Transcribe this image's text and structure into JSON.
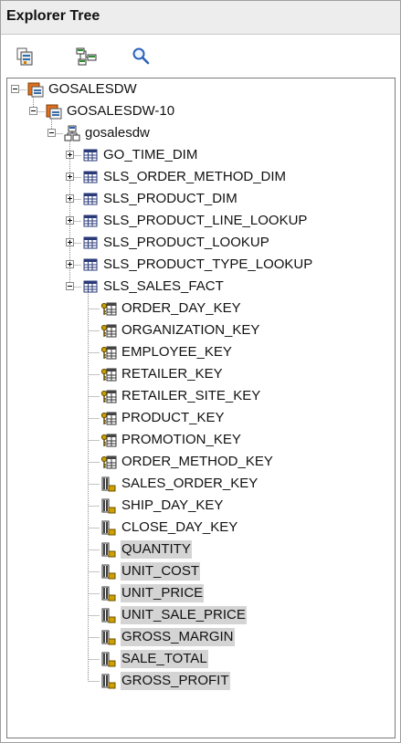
{
  "panel": {
    "title": "Explorer Tree"
  },
  "toolbar": [
    {
      "name": "open-model-icon"
    },
    {
      "name": "tree-structure-icon"
    },
    {
      "name": "search-icon"
    }
  ],
  "tree": [
    {
      "label": "GOSALESDW",
      "icon": "model-icon",
      "level": 0,
      "expander": "minus"
    },
    {
      "label": "GOSALESDW-10",
      "icon": "model-icon",
      "level": 1,
      "expander": "minus"
    },
    {
      "label": "gosalesdw",
      "icon": "schema-icon",
      "level": 2,
      "expander": "minus"
    },
    {
      "label": "GO_TIME_DIM",
      "icon": "table-icon",
      "level": 3,
      "expander": "plus"
    },
    {
      "label": "SLS_ORDER_METHOD_DIM",
      "icon": "table-icon",
      "level": 3,
      "expander": "plus"
    },
    {
      "label": "SLS_PRODUCT_DIM",
      "icon": "table-icon",
      "level": 3,
      "expander": "plus"
    },
    {
      "label": "SLS_PRODUCT_LINE_LOOKUP",
      "icon": "table-icon",
      "level": 3,
      "expander": "plus"
    },
    {
      "label": "SLS_PRODUCT_LOOKUP",
      "icon": "table-icon",
      "level": 3,
      "expander": "plus"
    },
    {
      "label": "SLS_PRODUCT_TYPE_LOOKUP",
      "icon": "table-icon",
      "level": 3,
      "expander": "plus"
    },
    {
      "label": "SLS_SALES_FACT",
      "icon": "table-icon",
      "level": 3,
      "expander": "minus"
    },
    {
      "label": "ORDER_DAY_KEY",
      "icon": "key-column-icon",
      "level": 4,
      "expander": "none"
    },
    {
      "label": "ORGANIZATION_KEY",
      "icon": "key-column-icon",
      "level": 4,
      "expander": "none"
    },
    {
      "label": "EMPLOYEE_KEY",
      "icon": "key-column-icon",
      "level": 4,
      "expander": "none"
    },
    {
      "label": "RETAILER_KEY",
      "icon": "key-column-icon",
      "level": 4,
      "expander": "none"
    },
    {
      "label": "RETAILER_SITE_KEY",
      "icon": "key-column-icon",
      "level": 4,
      "expander": "none"
    },
    {
      "label": "PRODUCT_KEY",
      "icon": "key-column-icon",
      "level": 4,
      "expander": "none"
    },
    {
      "label": "PROMOTION_KEY",
      "icon": "key-column-icon",
      "level": 4,
      "expander": "none"
    },
    {
      "label": "ORDER_METHOD_KEY",
      "icon": "key-column-icon",
      "level": 4,
      "expander": "none"
    },
    {
      "label": "SALES_ORDER_KEY",
      "icon": "measure-column-icon",
      "level": 4,
      "expander": "none"
    },
    {
      "label": "SHIP_DAY_KEY",
      "icon": "measure-column-icon",
      "level": 4,
      "expander": "none"
    },
    {
      "label": "CLOSE_DAY_KEY",
      "icon": "measure-column-icon",
      "level": 4,
      "expander": "none"
    },
    {
      "label": "QUANTITY",
      "icon": "measure-column-icon",
      "level": 4,
      "expander": "none",
      "selected": true
    },
    {
      "label": "UNIT_COST",
      "icon": "measure-column-icon",
      "level": 4,
      "expander": "none",
      "selected": true
    },
    {
      "label": "UNIT_PRICE",
      "icon": "measure-column-icon",
      "level": 4,
      "expander": "none",
      "selected": true
    },
    {
      "label": "UNIT_SALE_PRICE",
      "icon": "measure-column-icon",
      "level": 4,
      "expander": "none",
      "selected": true
    },
    {
      "label": "GROSS_MARGIN",
      "icon": "measure-column-icon",
      "level": 4,
      "expander": "none",
      "selected": true
    },
    {
      "label": "SALE_TOTAL",
      "icon": "measure-column-icon",
      "level": 4,
      "expander": "none",
      "selected": true
    },
    {
      "label": "GROSS_PROFIT",
      "icon": "measure-column-icon",
      "level": 4,
      "expander": "none",
      "selected": true
    }
  ],
  "colors": {
    "selection": "#d4d4d4",
    "model_icon": "#e07020",
    "key_icon": "#c8a000",
    "measure_icon": "#d0a000"
  }
}
